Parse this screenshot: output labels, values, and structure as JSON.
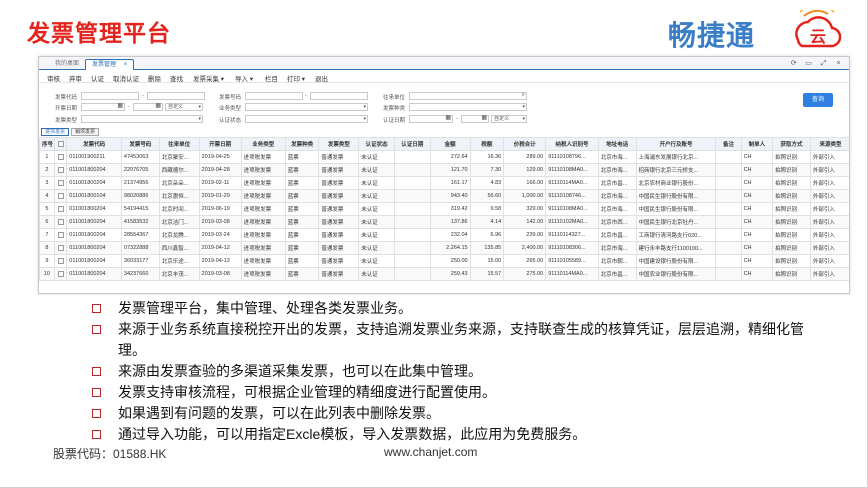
{
  "slide": {
    "title": "发票管理平台",
    "logo_text": "畅捷通",
    "logo_mark_text": "云"
  },
  "window": {
    "tabs": [
      "我的桌面",
      "发票管理"
    ],
    "tab_close": "×",
    "controls": [
      "⟳",
      "▭",
      "⤢",
      "×"
    ],
    "menu": [
      "审核",
      "弃审",
      "认证",
      "取消认证",
      "删除",
      "查找",
      "发票采集 ▾",
      "导入 ▾",
      "栏目",
      "打印 ▾",
      "退出"
    ]
  },
  "filter": {
    "invoice_code_label": "发票代码",
    "invoice_no_label": "发票号码",
    "buyer_label": "往来单位",
    "open_date_label": "开票日期",
    "custom_option": "自定义",
    "business_type_label": "业务类型",
    "invoice_kind_label": "发票种类",
    "invoice_type_label": "发票类型",
    "cert_status_label": "认证状态",
    "cert_date_label": "认证日期",
    "range_sep": "-",
    "search_button": "查询"
  },
  "subtabs": [
    "进项发票",
    "销项发票"
  ],
  "table": {
    "headers": [
      "序号",
      "",
      "发票代码",
      "发票号码",
      "往来单位",
      "开票日期",
      "业务类型",
      "发票种类",
      "发票类型",
      "认证状态",
      "认证日期",
      "金额",
      "税额",
      "价税合计",
      "纳税人识别号",
      "地址电话",
      "开户行及账号",
      "备注",
      "制单人",
      "获取方式",
      "来源类型"
    ],
    "rows": [
      [
        "1",
        "011001900211",
        "47453063",
        "北京聚安...",
        "2019-04-25",
        "进项税发票",
        "蓝票",
        "普通发票",
        "未认证",
        "",
        "272.64",
        "16.36",
        "289.00",
        "91110108796...",
        "北京市海...",
        "上海浦东发展银行北京...",
        "",
        "CH",
        "拍照识别",
        "外部引入"
      ],
      [
        "2",
        "011001800204",
        "22076705",
        "西藏德尔...",
        "2019-04-28",
        "进项税发票",
        "蓝票",
        "普通发票",
        "未认证",
        "",
        "121.70",
        "7.30",
        "129.00",
        "91110108MA0...",
        "北京市海...",
        "招商银行北京三元桥支...",
        "",
        "CH",
        "拍照识别",
        "外部引入"
      ],
      [
        "3",
        "011001800204",
        "21374956",
        "北京朵朵...",
        "2019-02-11",
        "进项税发票",
        "蓝票",
        "普通发票",
        "未认证",
        "",
        "161.17",
        "4.83",
        "166.00",
        "91110114MA0...",
        "北京市昌...",
        "北京农村商业银行股份...",
        "",
        "CH",
        "拍照识别",
        "外部引入"
      ],
      [
        "4",
        "011001800104",
        "98020886",
        "北京惠恒...",
        "2019-01-29",
        "进项税发票",
        "蓝票",
        "普通发票",
        "未认证",
        "",
        "943.40",
        "56.60",
        "1,000.00",
        "91110108746...",
        "北京市海...",
        "中国民生银行股份有限...",
        "",
        "CH",
        "拍照识别",
        "外部引入"
      ],
      [
        "5",
        "011001800204",
        "54194415",
        "北京时间...",
        "2019-06-19",
        "进项税发票",
        "蓝票",
        "普通发票",
        "未认证",
        "",
        "319.42",
        "9.58",
        "329.00",
        "91110108MA0...",
        "北京市海...",
        "中国民生银行股份有限...",
        "",
        "CH",
        "拍照识别",
        "外部引入"
      ],
      [
        "6",
        "011001800204",
        "41583532",
        "北京洁门...",
        "2019-03-08",
        "进项税发票",
        "蓝票",
        "普通发票",
        "未认证",
        "",
        "137.86",
        "4.14",
        "142.00",
        "91110102MA0...",
        "北京市西...",
        "中国民生银行北京牡丹...",
        "",
        "CH",
        "拍照识别",
        "外部引入"
      ],
      [
        "7",
        "011001800204",
        "28554367",
        "北京龙腾...",
        "2019-03-24",
        "进项税发票",
        "蓝票",
        "普通发票",
        "未认证",
        "",
        "232.04",
        "6.96",
        "239.00",
        "91110114327...",
        "北京市昌...",
        "工商银行清河路支行020...",
        "",
        "CH",
        "拍照识别",
        "外部引入"
      ],
      [
        "8",
        "011001800204",
        "07322888",
        "西川鑫智...",
        "2019-04-12",
        "进项税发票",
        "蓝票",
        "普通发票",
        "未认证",
        "",
        "2,264.15",
        "135.85",
        "2,400.00",
        "91110108306...",
        "北京市海...",
        "建行永丰路支行1100100...",
        "",
        "CH",
        "拍照识别",
        "外部引入"
      ],
      [
        "9",
        "011001800204",
        "36033177",
        "北京乐途...",
        "2019-04-13",
        "进项税发票",
        "蓝票",
        "普通发票",
        "未认证",
        "",
        "250.00",
        "15.00",
        "265.00",
        "91110105589...",
        "北京市朝...",
        "中国建设银行股份有限...",
        "",
        "CH",
        "拍照识别",
        "外部引入"
      ],
      [
        "10",
        "011001800204",
        "34237660",
        "北京丰茂...",
        "2019-03-08",
        "进项税发票",
        "蓝票",
        "普通发票",
        "未认证",
        "",
        "259.43",
        "15.57",
        "275.00",
        "91110114MA0...",
        "北京市昌...",
        "中国农业银行股份有限...",
        "",
        "CH",
        "拍照识别",
        "外部引入"
      ]
    ]
  },
  "bullets": [
    "发票管理平台，集中管理、处理各类发票业务。",
    "来源于业务系统直接税控开出的发票，支持追溯发票业务来源，支持联查生成的核算凭证，层层追溯，精细化管理。",
    "来源由发票查验的多渠道采集发票，也可以在此集中管理。",
    "发票支持审核流程，可根据企业管理的精细度进行配置使用。",
    "如果遇到有问题的发票，可以在此列表中删除发票。",
    "通过导入功能，可以用指定Excle模板，导入发票数据，此应用为免费服务。"
  ],
  "footer": {
    "stock_code": "股票代码：01588.HK",
    "url": "www.chanjet.com"
  },
  "colors": {
    "title_red": "#e4231d",
    "brand_blue": "#2f79c4",
    "bullet_red": "#c0262c",
    "button_blue": "#2f7fe0"
  }
}
